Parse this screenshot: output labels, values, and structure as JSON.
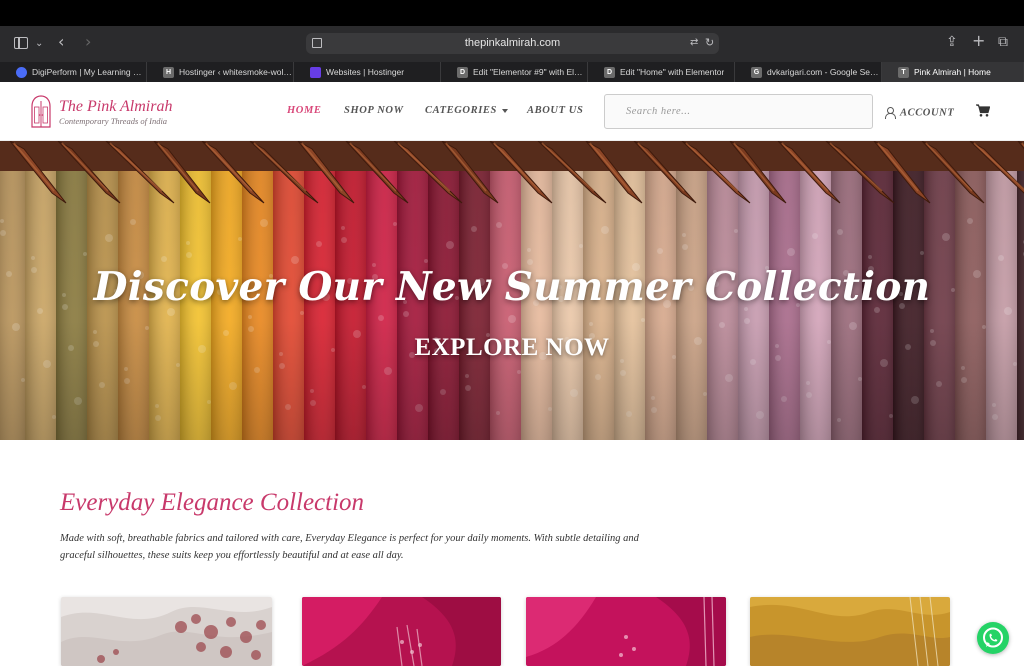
{
  "browser": {
    "url": "thepinkalmirah.com",
    "tabs": [
      {
        "label": "DigiPerform | My Learning Plan",
        "favicon_letter": "",
        "favicon_color": "#4a6cf7"
      },
      {
        "label": "Hostinger ‹ whitesmoke-wol…",
        "favicon_letter": "H",
        "favicon_color": "#6b6b6b"
      },
      {
        "label": "Websites | Hostinger",
        "favicon_letter": "",
        "favicon_color": "#673de6"
      },
      {
        "label": "Edit \"Elementor #9\" with Ele…",
        "favicon_letter": "D",
        "favicon_color": "#6b6b6b"
      },
      {
        "label": "Edit \"Home\" with Elementor",
        "favicon_letter": "D",
        "favicon_color": "#6b6b6b"
      },
      {
        "label": "dvkarigari.com - Google Sea…",
        "favicon_letter": "G",
        "favicon_color": "#6b6b6b"
      },
      {
        "label": "Pink Almirah | Home",
        "favicon_letter": "T",
        "favicon_color": "#6b6b6b"
      }
    ]
  },
  "site": {
    "logo_title": "The Pink Almirah",
    "logo_subtitle": "Contemporary Threads of India",
    "nav": {
      "home": "HOME",
      "shop": "SHOP NOW",
      "categories": "CATEGORIES",
      "about": "ABOUT US"
    },
    "search_placeholder": "Search here...",
    "account_label": "ACCOUNT",
    "accent_color": "#d9487a"
  },
  "hero": {
    "title": "Discover Our New Summer Collection",
    "cta": "EXPLORE NOW",
    "slides": 3,
    "active_slide": 1
  },
  "collection": {
    "title": "Everyday Elegance Collection",
    "description": "Made with soft, breathable fabrics and tailored with care, Everyday Elegance is perfect for your daily moments. With subtle detailing and graceful silhouettes, these suits keep you effortlessly beautiful and at ease all day."
  }
}
